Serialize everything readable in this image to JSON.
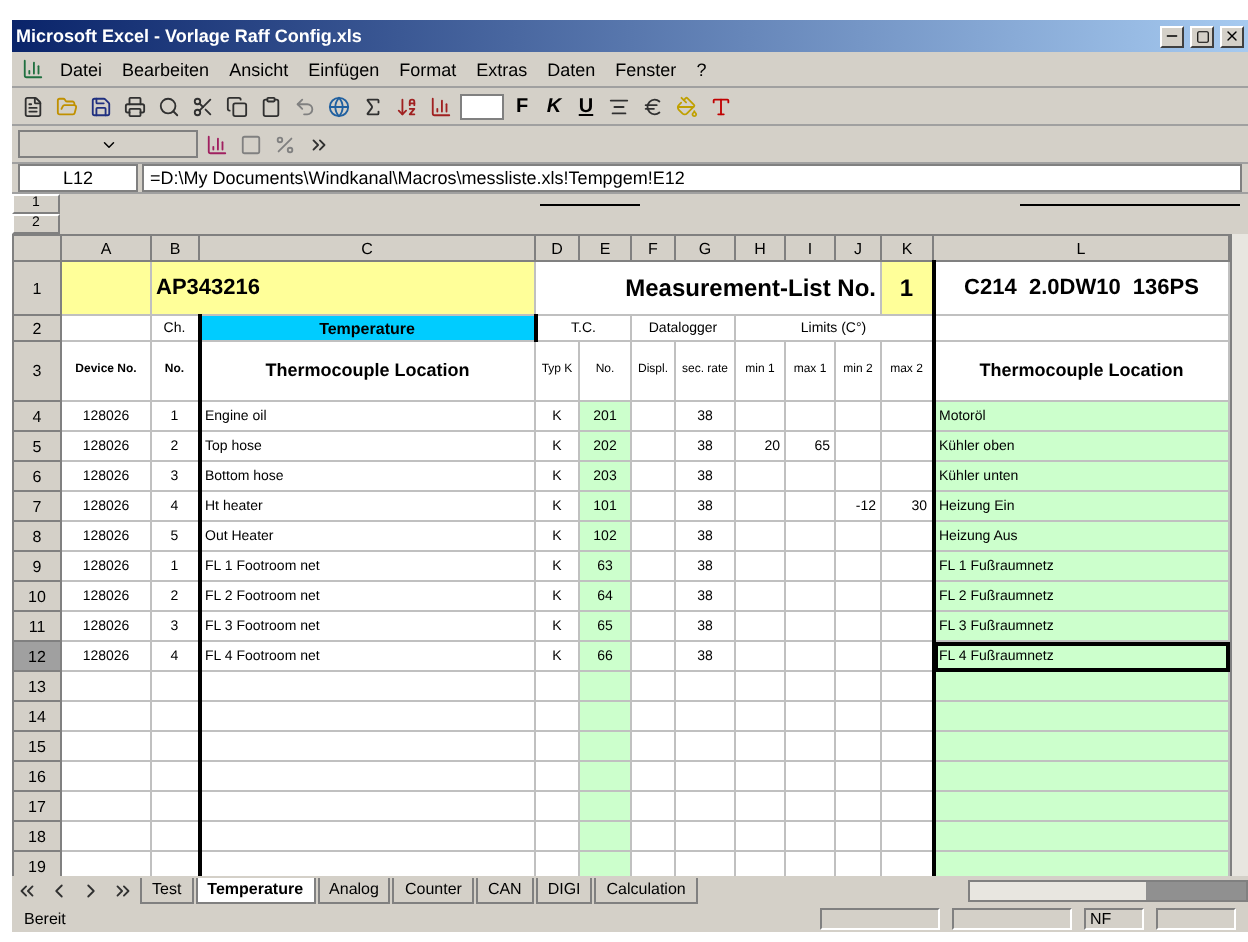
{
  "window": {
    "title": "Microsoft Excel - Vorlage Raff Config.xls"
  },
  "menu": [
    "Datei",
    "Bearbeiten",
    "Ansicht",
    "Einfügen",
    "Format",
    "Extras",
    "Daten",
    "Fenster",
    "?"
  ],
  "format_buttons": [
    "F",
    "K",
    "U"
  ],
  "name_box": "L12",
  "formula": "=D:\\My Documents\\Windkanal\\Macros\\messliste.xls!Tempgem!E12",
  "outline_levels": [
    "1",
    "2"
  ],
  "columns": [
    "A",
    "B",
    "C",
    "D",
    "E",
    "F",
    "G",
    "H",
    "I",
    "J",
    "K",
    "L"
  ],
  "title_row": {
    "number": "1",
    "order_no": "AP343216",
    "list_label": "Measurement-List No.",
    "list_no": "1",
    "vehicle": "C214  2.0DW10  136PS"
  },
  "group_row": {
    "number": "2",
    "ch": "Ch.",
    "temperature": "Temperature",
    "tc": "T.C.",
    "datalogger": "Datalogger",
    "limits": "Limits (C°)"
  },
  "column_row": {
    "number": "3",
    "device": "Device No.",
    "ch": "No.",
    "location": "Thermocouple Location",
    "tc_type": "Typ K",
    "tc_no": "No.",
    "displ": "Displ.",
    "rate": "sec. rate",
    "min1": "min 1",
    "max1": "max 1",
    "min2": "min 2",
    "max2": "max 2",
    "location_de": "Thermocouple Location"
  },
  "rows": [
    {
      "number": "4",
      "selected": false,
      "device": "128026",
      "ch": "1",
      "location": "Engine oil",
      "tc_type": "K",
      "tc_no": "201",
      "rate": "38",
      "location_de": "Motoröl"
    },
    {
      "number": "5",
      "selected": false,
      "device": "128026",
      "ch": "2",
      "location": "Top hose",
      "tc_type": "K",
      "tc_no": "202",
      "rate": "38",
      "min1": "20",
      "max1": "65",
      "location_de": "Kühler oben"
    },
    {
      "number": "6",
      "selected": false,
      "device": "128026",
      "ch": "3",
      "location": "Bottom hose",
      "tc_type": "K",
      "tc_no": "203",
      "rate": "38",
      "location_de": "Kühler unten"
    },
    {
      "number": "7",
      "selected": false,
      "device": "128026",
      "ch": "4",
      "location": "Ht heater",
      "tc_type": "K",
      "tc_no": "101",
      "rate": "38",
      "min2": "-12",
      "max2": "30",
      "location_de": "Heizung Ein"
    },
    {
      "number": "8",
      "selected": false,
      "device": "128026",
      "ch": "5",
      "location": "Out Heater",
      "tc_type": "K",
      "tc_no": "102",
      "rate": "38",
      "location_de": "Heizung Aus"
    },
    {
      "number": "9",
      "selected": false,
      "device": "128026",
      "ch": "1",
      "location": "FL 1 Footroom net",
      "tc_type": "K",
      "tc_no": "63",
      "rate": "38",
      "location_de": "FL 1 Fußraumnetz"
    },
    {
      "number": "10",
      "selected": false,
      "device": "128026",
      "ch": "2",
      "location": "FL 2 Footroom net",
      "tc_type": "K",
      "tc_no": "64",
      "rate": "38",
      "location_de": "FL 2 Fußraumnetz"
    },
    {
      "number": "11",
      "selected": false,
      "device": "128026",
      "ch": "3",
      "location": "FL 3 Footroom net",
      "tc_type": "K",
      "tc_no": "65",
      "rate": "38",
      "location_de": "FL 3 Fußraumnetz"
    },
    {
      "number": "12",
      "selected": true,
      "device": "128026",
      "ch": "4",
      "location": "FL 4 Footroom net",
      "tc_type": "K",
      "tc_no": "66",
      "rate": "38",
      "location_de": "FL 4 Fußraumnetz"
    }
  ],
  "empty_rows": [
    "13",
    "14",
    "15",
    "16",
    "17",
    "18",
    "19"
  ],
  "sheet_tabs": [
    {
      "label": "Test",
      "selected": false
    },
    {
      "label": "Temperature",
      "selected": true
    },
    {
      "label": "Analog",
      "selected": false
    },
    {
      "label": "Counter",
      "selected": false
    },
    {
      "label": "CAN",
      "selected": false
    },
    {
      "label": "DIGI",
      "selected": false
    },
    {
      "label": "Calculation",
      "selected": false
    }
  ],
  "status": {
    "text": "Bereit",
    "mode": "NF"
  }
}
